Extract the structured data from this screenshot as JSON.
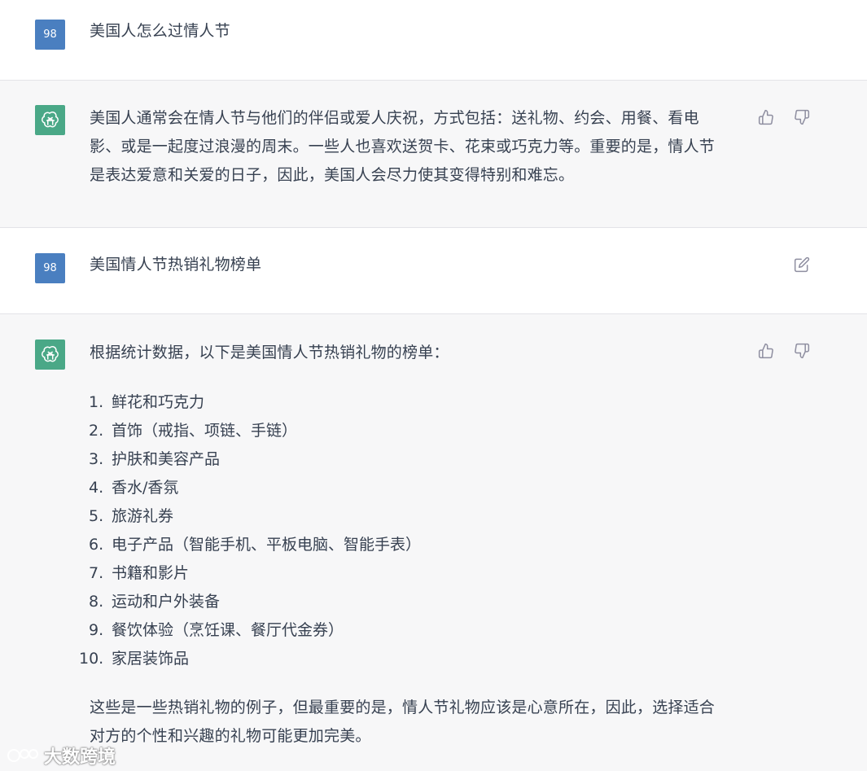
{
  "conversation": [
    {
      "role": "user",
      "avatar": "98",
      "text": "美国人怎么过情人节"
    },
    {
      "role": "assistant",
      "paragraphs": [
        "美国人通常会在情人节与他们的伴侣或爱人庆祝，方式包括：送礼物、约会、用餐、看电",
        "影、或是一起度过浪漫的周末。一些人也喜欢送贺卡、花束或巧克力等。重要的是，情人节",
        "是表达爱意和关爱的日子，因此，美国人会尽力使其变得特别和难忘。"
      ]
    },
    {
      "role": "user",
      "avatar": "98",
      "text": "美国情人节热销礼物榜单"
    },
    {
      "role": "assistant",
      "intro": "根据统计数据，以下是美国情人节热销礼物的榜单：",
      "list": [
        {
          "n": "1.",
          "t": "鲜花和巧克力"
        },
        {
          "n": "2.",
          "t": "首饰（戒指、项链、手链）"
        },
        {
          "n": "3.",
          "t": "护肤和美容产品"
        },
        {
          "n": "4.",
          "t": "香水/香氛"
        },
        {
          "n": "5.",
          "t": "旅游礼券"
        },
        {
          "n": "6.",
          "t": "电子产品（智能手机、平板电脑、智能手表）"
        },
        {
          "n": "7.",
          "t": "书籍和影片"
        },
        {
          "n": "8.",
          "t": "运动和户外装备"
        },
        {
          "n": "9.",
          "t": "餐饮体验（烹饪课、餐厅代金券）"
        },
        {
          "n": "10.",
          "t": "家居装饰品"
        }
      ],
      "outro": [
        "这些是一些热销礼物的例子，但最重要的是，情人节礼物应该是心意所在，因此，选择适合",
        "对方的个性和兴趣的礼物可能更加完美。"
      ]
    }
  ],
  "icons": {
    "thumbs_up": "thumbs-up-icon",
    "thumbs_down": "thumbs-down-icon",
    "edit": "edit-icon",
    "bot_logo": "openai-logo-icon"
  },
  "watermark": {
    "text": "大数跨境"
  },
  "colors": {
    "user_avatar": "#4a7fc0",
    "bot_avatar": "#4aa887",
    "bot_bg": "#f7f7f8"
  }
}
